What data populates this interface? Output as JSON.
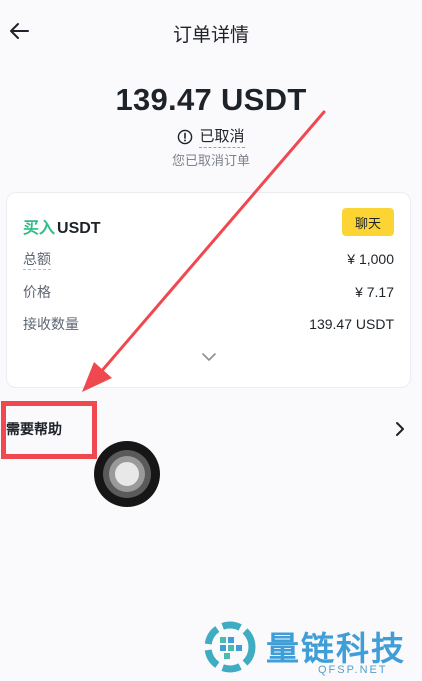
{
  "header": {
    "title": "订单详情",
    "back_icon": "arrow-left-icon"
  },
  "order": {
    "amount": "139.47 USDT",
    "status": "已取消",
    "status_icon": "info-circle-icon",
    "status_note": "您已取消订单"
  },
  "card": {
    "side": "买入",
    "asset": "USDT",
    "chat_label": "聊天",
    "rows": [
      {
        "label": "总额",
        "value": "¥ 1,000"
      },
      {
        "label": "价格",
        "value": "¥ 7.17"
      },
      {
        "label": "接收数量",
        "value": "139.47 USDT"
      }
    ],
    "expand_icon": "chevron-down-icon"
  },
  "help": {
    "label": "需要帮助",
    "chevron_icon": "chevron-right-icon"
  },
  "watermark": {
    "name": "量链科技",
    "domain": "QFSP.NET"
  },
  "colors": {
    "buy": "#2ebd85",
    "chat_button": "#fcd535",
    "annotation": "#f0484f",
    "watermark": "#1f8fd1"
  }
}
